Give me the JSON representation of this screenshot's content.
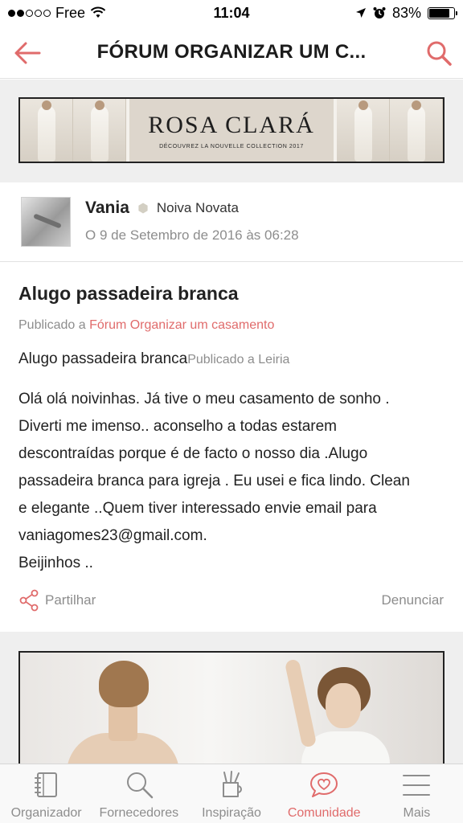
{
  "status_bar": {
    "carrier": "Free",
    "time": "11:04",
    "battery": "83%",
    "battery_level": 0.83,
    "signal_bars_filled": 2,
    "signal_bars_total": 5
  },
  "header": {
    "title": "FÓRUM ORGANIZAR UM C...",
    "back_icon": "arrow-left-icon",
    "search_icon": "search-icon"
  },
  "ad_top": {
    "brand": "ROSA CLARÁ",
    "tagline": "DÉCOUVREZ LA NOUVELLE COLLECTION 2017"
  },
  "post": {
    "author": "Vania",
    "rank": "Noiva Novata",
    "date": "O 9 de Setembro de 2016 às 06:28",
    "title": "Alugo passadeira branca",
    "published_prefix": "Publicado a ",
    "forum": "Fórum Organizar um casamento",
    "subtitle": "Alugo passadeira branca",
    "location_prefix": "Publicado a ",
    "location": "Leiria",
    "body_lines": [
      "Olá olá noivinhas. Já tive o meu casamento de sonho .",
      "Diverti me imenso.. aconselho a todas estarem",
      "descontraídas porque é de facto o nosso dia .Alugo",
      "passadeira branca para igreja . Eu usei e fica lindo. Clean",
      "e elegante ..Quem tiver interessado envie email para",
      "vaniagomes23@gmail.com.",
      "Beijinhos .."
    ],
    "share_label": "Partilhar",
    "report_label": "Denunciar"
  },
  "tabs": [
    {
      "label": "Organizador",
      "icon": "notebook-icon",
      "active": false
    },
    {
      "label": "Fornecedores",
      "icon": "search-icon",
      "active": false
    },
    {
      "label": "Inspiração",
      "icon": "pencil-cup-icon",
      "active": false
    },
    {
      "label": "Comunidade",
      "icon": "heart-bubble-icon",
      "active": true
    },
    {
      "label": "Mais",
      "icon": "menu-icon",
      "active": false
    }
  ],
  "colors": {
    "accent": "#e06b6b",
    "muted": "#8d8d8d",
    "text": "#222222"
  }
}
